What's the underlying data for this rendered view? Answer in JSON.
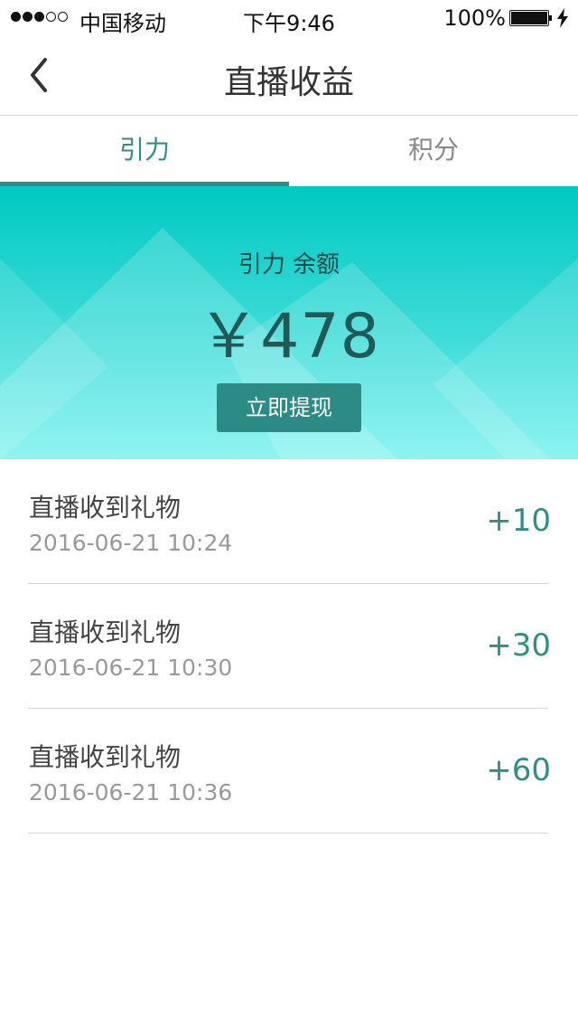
{
  "status_bar": {
    "carrier": "中国移动",
    "time": "下午9:46",
    "battery": "100%"
  },
  "nav": {
    "title": "直播收益",
    "back_icon": "chevron-left-icon"
  },
  "tabs": [
    {
      "label": "引力",
      "active": true
    },
    {
      "label": "积分",
      "active": false
    }
  ],
  "balance": {
    "label": "引力 余额",
    "amount": "￥478",
    "withdraw_label": "立即提现"
  },
  "records": [
    {
      "title": "直播收到礼物",
      "time": "2016-06-21  10:24",
      "amount": "+10"
    },
    {
      "title": "直播收到礼物",
      "time": "2016-06-21  10:30",
      "amount": "+30"
    },
    {
      "title": "直播收到礼物",
      "time": "2016-06-21  10:36",
      "amount": "+60"
    }
  ],
  "colors": {
    "accent": "#2f8f88",
    "banner_top": "#00c9c1",
    "banner_bottom": "#78f2ee",
    "button": "#2d8b85"
  }
}
